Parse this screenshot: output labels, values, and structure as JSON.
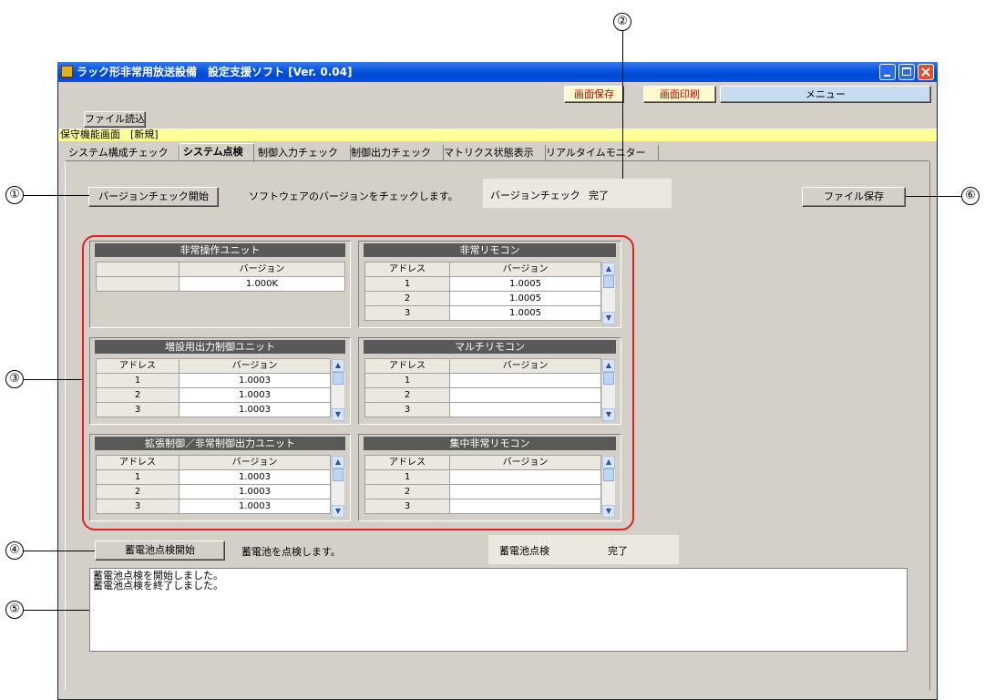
{
  "window": {
    "title": "ラック形非常用放送設備　設定支援ソフト [Ver. 0.04]",
    "controls": [
      "minimize-icon",
      "maximize-icon",
      "close-icon"
    ]
  },
  "toolbar": {
    "screen_save": "画面保存",
    "screen_print": "画面印刷",
    "menu": "メニュー",
    "file_load": "ファイル読込"
  },
  "mode_label": "保守機能画面　[新規]",
  "tabs": [
    {
      "label": "システム構成チェック",
      "active": false
    },
    {
      "label": "システム点検",
      "active": true
    },
    {
      "label": "制御入力チェック",
      "active": false
    },
    {
      "label": "制御出力チェック",
      "active": false
    },
    {
      "label": "マトリクス状態表示",
      "active": false
    },
    {
      "label": "リアルタイムモニター",
      "active": false
    }
  ],
  "version_check": {
    "button": "バージョンチェック開始",
    "description": "ソフトウェアのバージョンをチェックします。",
    "status_label": "バージョンチェック",
    "status_value": "完了"
  },
  "file_save": "ファイル保存",
  "panels": {
    "emergency_op_unit": {
      "title": "非常操作ユニット",
      "col_version": "バージョン",
      "value": "1.000K"
    },
    "emergency_remote": {
      "title": "非常リモコン",
      "col_address": "アドレス",
      "col_version": "バージョン",
      "rows": [
        [
          "1",
          "1.0005"
        ],
        [
          "2",
          "1.0005"
        ],
        [
          "3",
          "1.0005"
        ]
      ]
    },
    "expansion_output_unit": {
      "title": "増設用出力制御ユニット",
      "col_address": "アドレス",
      "col_version": "バージョン",
      "rows": [
        [
          "1",
          "1.0003"
        ],
        [
          "2",
          "1.0003"
        ],
        [
          "3",
          "1.0003"
        ]
      ]
    },
    "multi_remote": {
      "title": "マルチリモコン",
      "col_address": "アドレス",
      "col_version": "バージョン",
      "rows": [
        [
          "1",
          ""
        ],
        [
          "2",
          ""
        ],
        [
          "3",
          ""
        ]
      ]
    },
    "extended_control_unit": {
      "title": "拡張制御／非常制御出力ユニット",
      "col_address": "アドレス",
      "col_version": "バージョン",
      "rows": [
        [
          "1",
          "1.0003"
        ],
        [
          "2",
          "1.0003"
        ],
        [
          "3",
          "1.0003"
        ]
      ]
    },
    "central_emergency_remote": {
      "title": "集中非常リモコン",
      "col_address": "アドレス",
      "col_version": "バージョン",
      "rows": [
        [
          "1",
          ""
        ],
        [
          "2",
          ""
        ],
        [
          "3",
          ""
        ]
      ]
    }
  },
  "battery_check": {
    "button": "蓄電池点検開始",
    "description": "蓄電池を点検します。",
    "status_label": "蓄電池点検",
    "status_value": "完了"
  },
  "log": [
    "蓄電池点検を開始しました。",
    "蓄電池点検を終了しました。"
  ],
  "callouts": [
    "①",
    "②",
    "③",
    "④",
    "⑤",
    "⑥"
  ],
  "colors": {
    "titlebar": "#0a58e0",
    "highlight_bar": "#ffff99",
    "callout_box": "#e02020",
    "panel_header": "#595959"
  }
}
